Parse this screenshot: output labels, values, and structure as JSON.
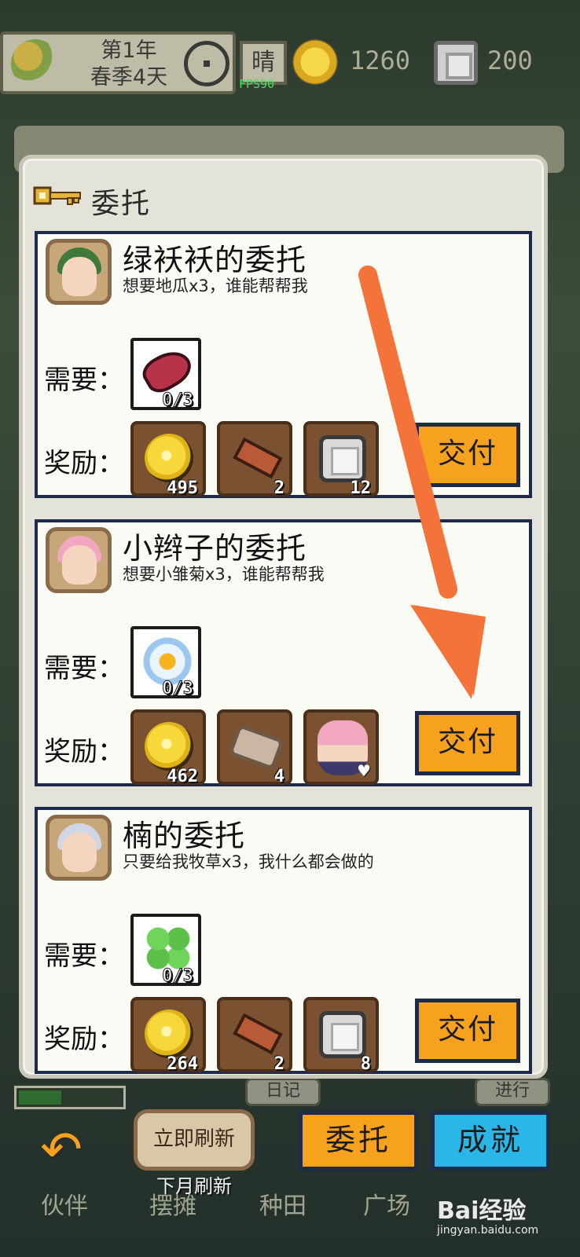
{
  "hud": {
    "date_line1": "第1年",
    "date_line2": "春季4天",
    "weather": "晴",
    "fps": "FPS90",
    "coins": "1260",
    "gems": "200"
  },
  "panel": {
    "title": "委托",
    "need_label": "需要：",
    "reward_label": "奖励：",
    "submit_label": "交付"
  },
  "quests": [
    {
      "title": "绿袄袄的委托",
      "desc": "想要地瓜x3，谁能帮帮我",
      "need": {
        "item": "sweet-potato",
        "progress": "0/3"
      },
      "rewards": [
        {
          "item": "coin",
          "qty": "495"
        },
        {
          "item": "wood",
          "qty": "2"
        },
        {
          "item": "stone",
          "qty": "12"
        }
      ]
    },
    {
      "title": "小辫子的委托",
      "desc": "想要小雏菊x3，谁能帮帮我",
      "need": {
        "item": "daisy",
        "progress": "0/3"
      },
      "rewards": [
        {
          "item": "coin",
          "qty": "462"
        },
        {
          "item": "cloth",
          "qty": "4"
        },
        {
          "item": "affection",
          "qty": "♥"
        }
      ]
    },
    {
      "title": "楠的委托",
      "desc": "只要给我牧草x3，我什么都会做的",
      "need": {
        "item": "grass",
        "progress": "0/3"
      },
      "rewards": [
        {
          "item": "coin",
          "qty": "264"
        },
        {
          "item": "wood",
          "qty": "2"
        },
        {
          "item": "stone",
          "qty": "8"
        }
      ]
    }
  ],
  "bottom": {
    "diary": "日记",
    "progress_tab": "进行",
    "refresh_button": "立即刷新",
    "refresh_sub": "下月刷新",
    "commission_button": "委托",
    "achievement_button": "成就",
    "nav": [
      "伙伴",
      "摆摊",
      "种田",
      "广场"
    ]
  },
  "watermark": {
    "brand": "Bai经验",
    "url": "jingyan.baidu.com"
  },
  "colors": {
    "submit": "#f6a21e",
    "achievement": "#2bb6e8",
    "card_border": "#1d2a4a",
    "arrow": "#f4733a"
  }
}
